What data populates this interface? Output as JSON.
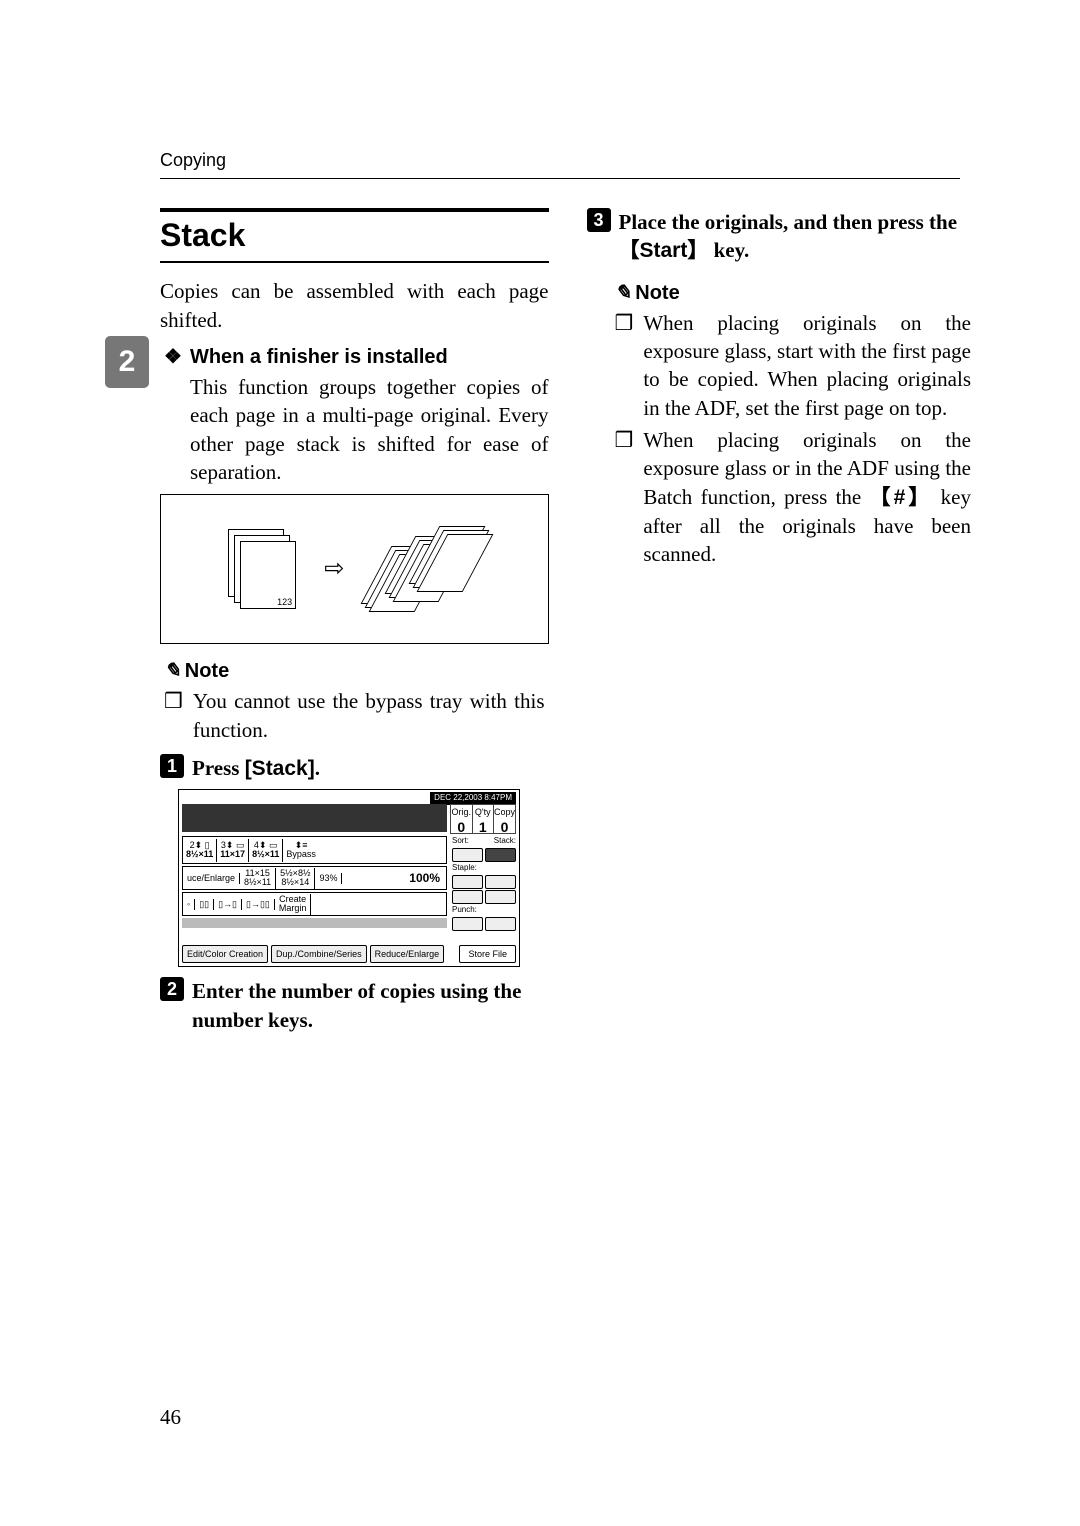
{
  "running_head": "Copying",
  "side_tab": "2",
  "page_number": "46",
  "left": {
    "heading": "Stack",
    "lead": "Copies can be assembled with each page shifted.",
    "finisher_head": "When a finisher is installed",
    "finisher_para": "This function groups together copies of each page in a multi-page original. Every other page stack is shifted for ease of separation.",
    "fig_nums": "123",
    "note_label": "Note",
    "note1": "You cannot use the bypass tray with this function.",
    "step1_prefix": "Press ",
    "step1_button": "[Stack]",
    "step1_suffix": ".",
    "screenshot": {
      "datetime": "DEC  22,2003  8:47PM",
      "orig_label": "Orig.",
      "qty_label": "Q'ty",
      "copy_label": "Copy",
      "orig_val": "0",
      "qty_val": "1",
      "copy_val": "0",
      "tray1": "2",
      "tray1b": "8½×11",
      "tray2": "3",
      "tray2b": "11×17",
      "tray3": "4",
      "tray3b": "8½×11",
      "bypass": "Bypass",
      "reduce_enlarge": "uce/Enlarge",
      "z1": "11×15\n8½×11",
      "z2": "5½×8½\n8½×14",
      "pct": "93%",
      "full": "100%",
      "create_margin": "Create\nMargin",
      "btn_edit": "Edit/Color Creation",
      "btn_dup": "Dup./Combine/Series",
      "btn_re": "Reduce/Enlarge",
      "store_file": "Store File",
      "sort_label": "Sort:",
      "stack_label": "Stack:",
      "staple_label": "Staple:",
      "punch_label": "Punch:"
    },
    "step2": "Enter the number of copies using the number keys."
  },
  "right": {
    "step3_a": "Place the originals, and then press the ",
    "step3_key": "Start",
    "step3_b": " key.",
    "note_label": "Note",
    "note1": "When placing originals on the exposure glass, start with the first page to be copied. When placing originals in the ADF, set the first page on top.",
    "note2_a": "When placing originals on the exposure glass or in the ADF using the Batch function, press the ",
    "note2_key": "#",
    "note2_b": " key after all the originals have been scanned."
  }
}
